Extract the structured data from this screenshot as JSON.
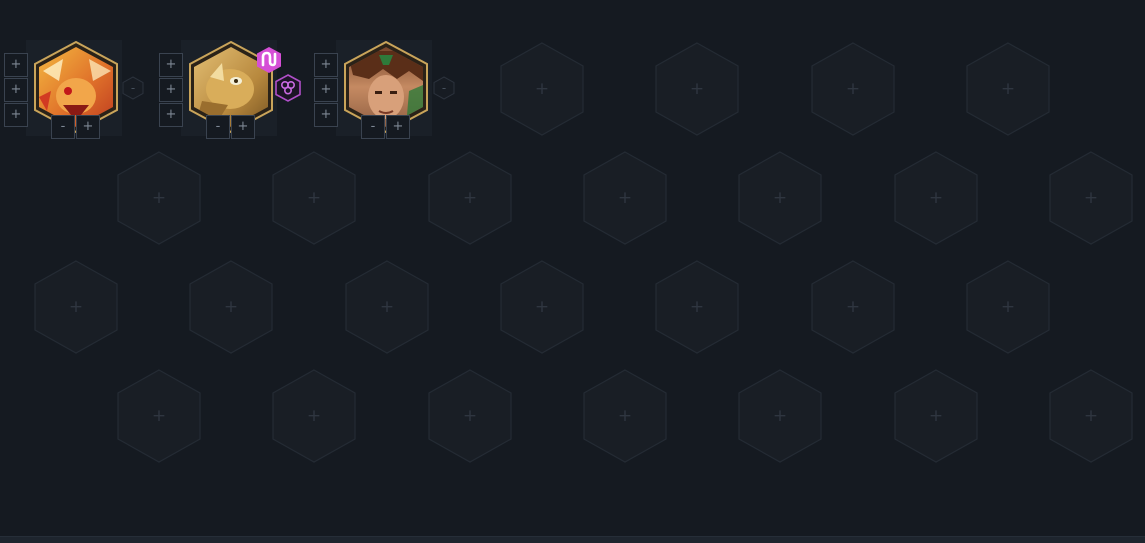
{
  "board": {
    "empty_slot_label": "+",
    "rows": 4,
    "columns": 7
  },
  "units": [
    {
      "name": "Fire fox champion",
      "frame_color": "#c9a45a",
      "portrait_colors": [
        "#f6c244",
        "#e0722a",
        "#b8321e"
      ],
      "items": [
        "+",
        "+",
        "+"
      ],
      "star_controls": [
        "-",
        "+"
      ],
      "side_control": "-"
    },
    {
      "name": "Golden beast champion",
      "frame_color": "#c9a45a",
      "portrait_colors": [
        "#e8c57a",
        "#b8893e",
        "#6e4c1e"
      ],
      "items": [
        "+",
        "+",
        "+"
      ],
      "star_controls": [
        "-",
        "+"
      ],
      "badge_icon": "ribbon-emblem-icon",
      "badge_color": "#d54fd6",
      "trait_icon": "triskelion-trait-icon",
      "trait_color": "#b04fc9"
    },
    {
      "name": "Brown haired warrior champion",
      "frame_color": "#c9a45a",
      "portrait_colors": [
        "#6b3a22",
        "#c58a62",
        "#2e7a3a"
      ],
      "items": [
        "+",
        "+",
        "+"
      ],
      "star_controls": [
        "-",
        "+"
      ],
      "side_control": "-"
    }
  ]
}
